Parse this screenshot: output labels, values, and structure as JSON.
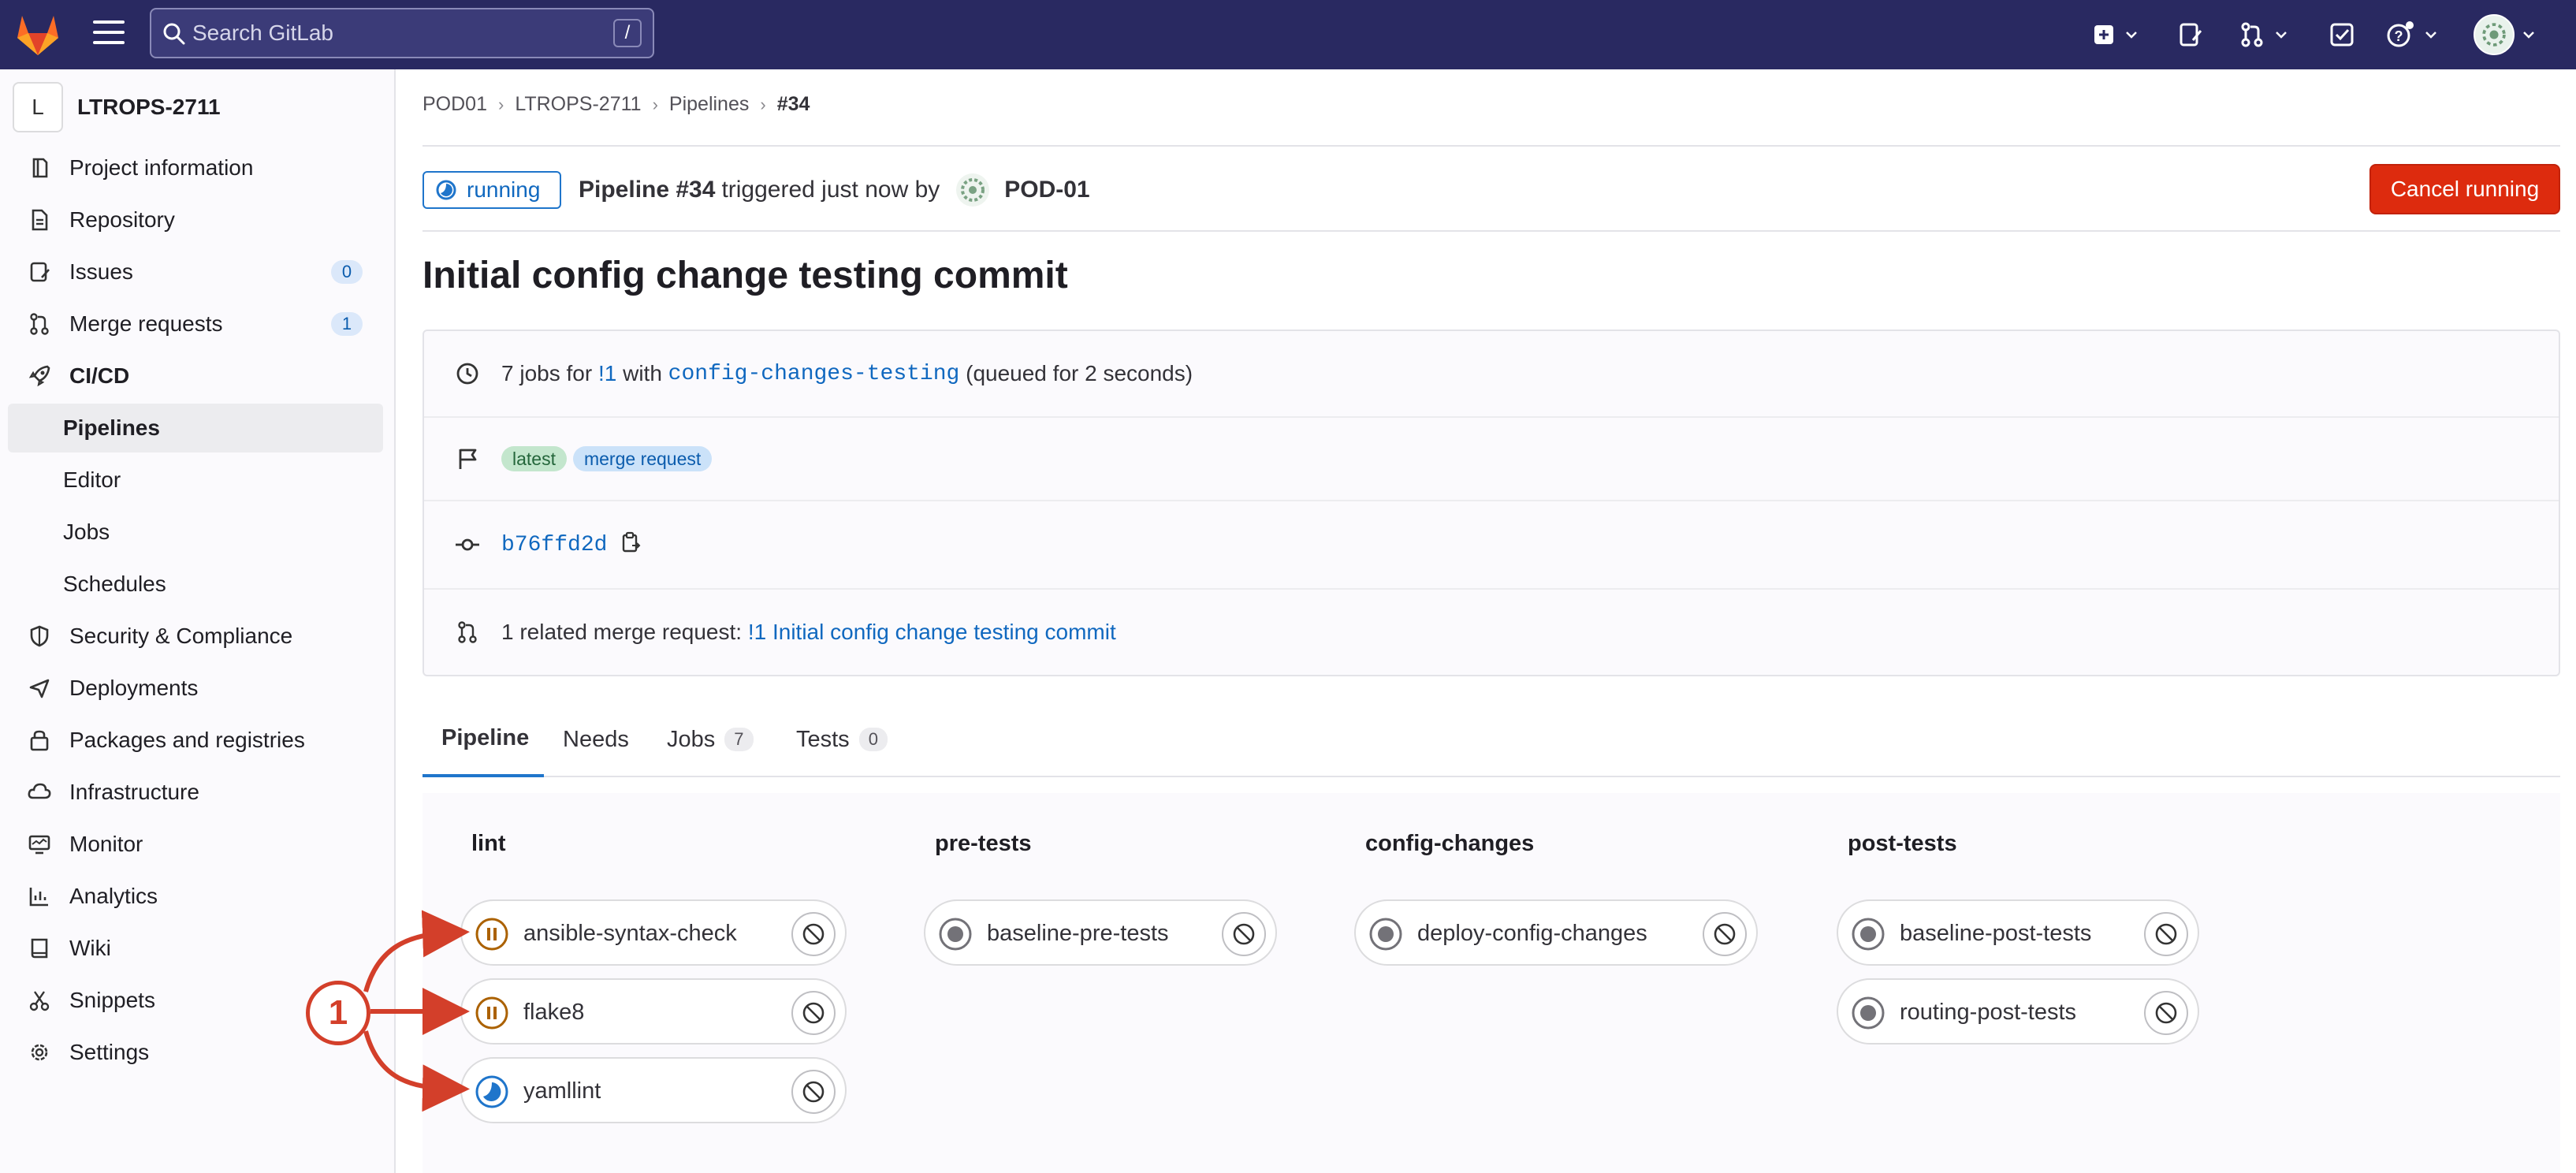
{
  "header": {
    "search_placeholder": "Search GitLab",
    "search_shortcut": "/"
  },
  "sidebar": {
    "project_initial": "L",
    "project_name": "LTROPS-2711",
    "items": [
      {
        "label": "Project information",
        "icon": "info-icon"
      },
      {
        "label": "Repository",
        "icon": "document-icon"
      },
      {
        "label": "Issues",
        "icon": "issues-icon",
        "count": "0"
      },
      {
        "label": "Merge requests",
        "icon": "merge-request-icon",
        "count": "1"
      },
      {
        "label": "CI/CD",
        "icon": "rocket-icon"
      },
      {
        "label": "Pipelines"
      },
      {
        "label": "Editor"
      },
      {
        "label": "Jobs"
      },
      {
        "label": "Schedules"
      },
      {
        "label": "Security & Compliance",
        "icon": "shield-icon"
      },
      {
        "label": "Deployments",
        "icon": "deployments-icon"
      },
      {
        "label": "Packages and registries",
        "icon": "package-icon"
      },
      {
        "label": "Infrastructure",
        "icon": "cloud-icon"
      },
      {
        "label": "Monitor",
        "icon": "monitor-icon"
      },
      {
        "label": "Analytics",
        "icon": "chart-icon"
      },
      {
        "label": "Wiki",
        "icon": "book-icon"
      },
      {
        "label": "Snippets",
        "icon": "scissors-icon"
      },
      {
        "label": "Settings",
        "icon": "gear-icon"
      }
    ]
  },
  "breadcrumb": [
    "POD01",
    "LTROPS-2711",
    "Pipelines",
    "#34"
  ],
  "pipeline": {
    "status": "running",
    "name": "Pipeline #34",
    "trigger_text": "triggered just now by",
    "user": "POD-01",
    "cancel_label": "Cancel running",
    "title": "Initial config change testing commit"
  },
  "info": {
    "jobs_prefix": "7 jobs for",
    "mr_ref": "!1",
    "with_text": "with",
    "branch": "config-changes-testing",
    "queued": "(queued for 2 seconds)",
    "badges": [
      "latest",
      "merge request"
    ],
    "commit_sha": "b76ffd2d",
    "related_prefix": "1 related merge request:",
    "related_link": "!1 Initial config change testing commit"
  },
  "tabs": [
    {
      "label": "Pipeline"
    },
    {
      "label": "Needs"
    },
    {
      "label": "Jobs",
      "count": "7"
    },
    {
      "label": "Tests",
      "count": "0"
    }
  ],
  "stages": [
    {
      "name": "lint",
      "jobs": [
        {
          "name": "ansible-syntax-check",
          "status": "pending"
        },
        {
          "name": "flake8",
          "status": "pending"
        },
        {
          "name": "yamllint",
          "status": "running"
        }
      ]
    },
    {
      "name": "pre-tests",
      "jobs": [
        {
          "name": "baseline-pre-tests",
          "status": "created"
        }
      ]
    },
    {
      "name": "config-changes",
      "jobs": [
        {
          "name": "deploy-config-changes",
          "status": "created"
        }
      ]
    },
    {
      "name": "post-tests",
      "jobs": [
        {
          "name": "baseline-post-tests",
          "status": "created"
        },
        {
          "name": "routing-post-tests",
          "status": "created"
        }
      ]
    }
  ],
  "annotation": {
    "number": "1"
  },
  "colors": {
    "topbar": "#292961",
    "link": "#1068bf",
    "danger": "#dd2b0e",
    "pending": "#ab6100",
    "running": "#1f75cb",
    "created": "#737278",
    "annotation": "#d33f2a"
  }
}
